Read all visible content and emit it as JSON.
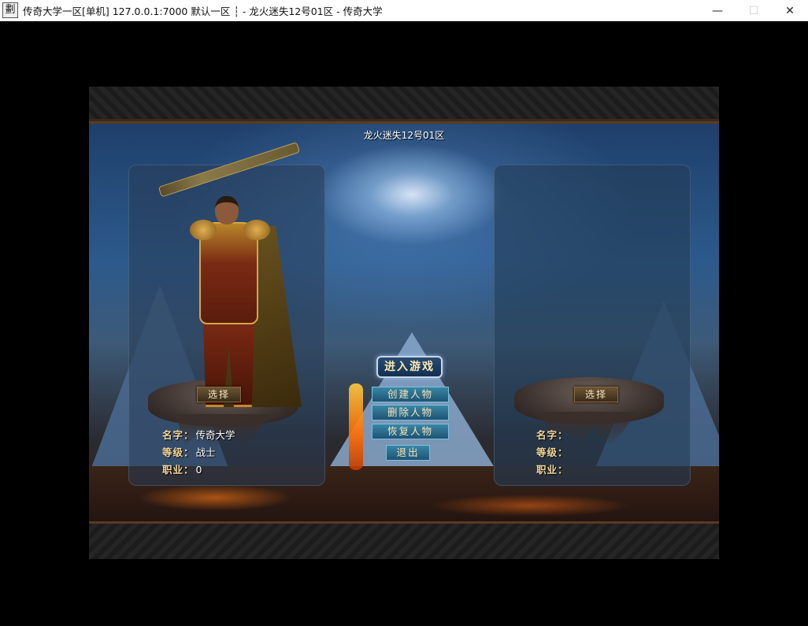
{
  "window": {
    "icon_glyph": "劃",
    "title": "传奇大学一区[单机] 127.0.0.1:7000  默认一区 ┆ - 龙火迷失12号01区 - 传奇大学",
    "minimize": "—",
    "maximize": "☐",
    "close": "✕"
  },
  "game": {
    "server_title": "龙火迷失12号01区",
    "menu": {
      "enter": "进入游戏",
      "create": "创建人物",
      "delete": "删除人物",
      "restore": "恢复人物",
      "exit": "退出"
    },
    "left_slot": {
      "select": "选择",
      "name_label": "名字：",
      "name_value": "传奇大学",
      "level_label": "等级：",
      "level_value": "战士",
      "job_label": "职业：",
      "job_value": "0"
    },
    "right_slot": {
      "select": "选择",
      "name_label": "名字：",
      "name_value": "",
      "level_label": "等级：",
      "level_value": "",
      "job_label": "职业：",
      "job_value": ""
    }
  }
}
